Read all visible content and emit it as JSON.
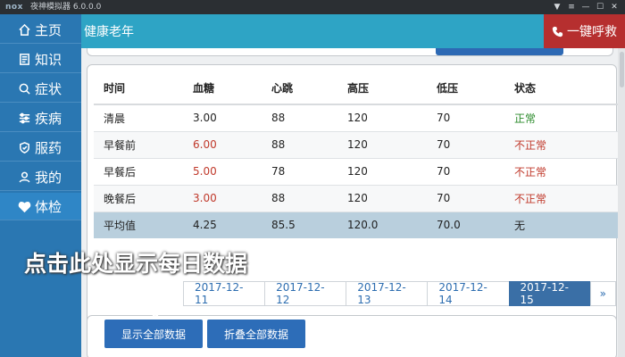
{
  "window": {
    "logo": "nox",
    "title": "夜神模拟器 6.0.0.0",
    "controls": [
      "▼",
      "≡",
      "—",
      "☐",
      "✕"
    ]
  },
  "sidebar": {
    "items": [
      {
        "icon": "home-icon",
        "label": "主页"
      },
      {
        "icon": "book-icon",
        "label": "知识"
      },
      {
        "icon": "search-icon",
        "label": "症状"
      },
      {
        "icon": "sliders-icon",
        "label": "疾病"
      },
      {
        "icon": "shield-icon",
        "label": "服药"
      },
      {
        "icon": "user-icon",
        "label": "我的"
      },
      {
        "icon": "heart-icon",
        "label": "体检"
      }
    ]
  },
  "header": {
    "title": "健康老年",
    "sos_label": "一键呼救"
  },
  "table": {
    "headers": [
      "时间",
      "血糖",
      "心跳",
      "高压",
      "低压",
      "状态"
    ],
    "rows": [
      {
        "time": "清晨",
        "sugar": "3.00",
        "heart": "88",
        "high": "120",
        "low": "70",
        "status": "正常",
        "abnormal": false
      },
      {
        "time": "早餐前",
        "sugar": "6.00",
        "heart": "88",
        "high": "120",
        "low": "70",
        "status": "不正常",
        "abnormal": true
      },
      {
        "time": "早餐后",
        "sugar": "5.00",
        "heart": "78",
        "high": "120",
        "low": "70",
        "status": "不正常",
        "abnormal": true
      },
      {
        "time": "晚餐后",
        "sugar": "3.00",
        "heart": "88",
        "high": "120",
        "low": "70",
        "status": "不正常",
        "abnormal": true
      }
    ],
    "average": {
      "time": "平均值",
      "sugar": "4.25",
      "heart": "85.5",
      "high": "120.0",
      "low": "70.0",
      "status": "无"
    }
  },
  "pagination": {
    "dates": [
      "2017-12-11",
      "2017-12-12",
      "2017-12-13",
      "2017-12-14",
      "2017-12-15"
    ],
    "active": "2017-12-15",
    "next_label": "»"
  },
  "buttons": {
    "show_all": "显示全部数据",
    "collapse_all": "折叠全部数据"
  },
  "annotation": {
    "text": "点击此处显示每日数据"
  },
  "colors": {
    "sidebar": "#2a77b2",
    "header": "#2ea4c5",
    "sos": "#b62f2f",
    "abnormal": "#c0392b",
    "normal": "#2a8a2a"
  }
}
